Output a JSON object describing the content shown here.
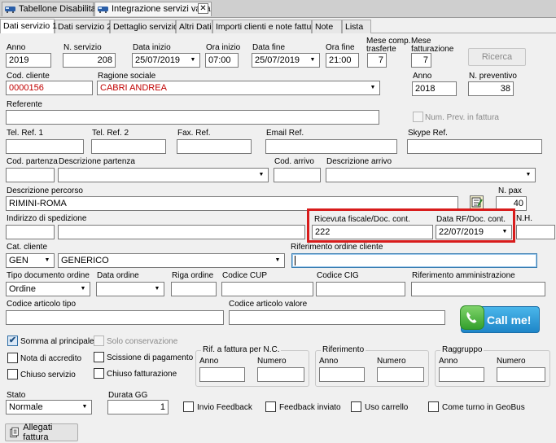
{
  "window_tabs": [
    {
      "label": "Tabellone Disabilitato"
    },
    {
      "label": "Integrazione servizi varia",
      "close": "✕"
    }
  ],
  "tabs": [
    "Dati servizio 1",
    "Dati servizio 2",
    "Dettaglio servizio",
    "Altri Dati",
    "Importi clienti e note fattura",
    "Note",
    "Lista"
  ],
  "row1": {
    "anno_label": "Anno",
    "anno": "2019",
    "n_servizio_label": "N. servizio",
    "n_servizio": "208",
    "data_inizio_label": "Data inizio",
    "data_inizio": "25/07/2019",
    "ora_inizio_label": "Ora inizio",
    "ora_inizio": "07:00",
    "data_fine_label": "Data fine",
    "data_fine": "25/07/2019",
    "ora_fine_label": "Ora fine",
    "ora_fine": "21:00",
    "mese_comp_label1": "Mese comp.",
    "mese_comp_label2": "trasferte",
    "mese_comp": "7",
    "mese_fatt_label1": "Mese",
    "mese_fatt_label2": "fatturazione",
    "mese_fatt": "7",
    "ricerca_label": "Ricerca"
  },
  "row2": {
    "cod_cliente_label": "Cod. cliente",
    "cod_cliente": "0000156",
    "ragione_sociale_label": "Ragione sociale",
    "ragione_sociale": "CABRI ANDREA",
    "anno_label": "Anno",
    "anno": "2018",
    "n_preventivo_label": "N. preventivo",
    "n_preventivo": "38"
  },
  "row3": {
    "referente_label": "Referente",
    "referente": "",
    "num_prev_label": "Num. Prev. in fattura"
  },
  "row4": {
    "tel1_label": "Tel. Ref. 1",
    "tel2_label": "Tel. Ref. 2",
    "fax_label": "Fax. Ref.",
    "email_label": "Email Ref.",
    "skype_label": "Skype Ref."
  },
  "row5": {
    "cod_partenza_label": "Cod. partenza",
    "desc_partenza_label": "Descrizione partenza",
    "cod_arrivo_label": "Cod. arrivo",
    "desc_arrivo_label": "Descrizione arrivo"
  },
  "row6": {
    "percorso_label": "Descrizione percorso",
    "percorso": "RIMINI-ROMA",
    "n_pax_label": "N. pax",
    "n_pax": "40"
  },
  "row7": {
    "indirizzo_label": "Indirizzo di spedizione",
    "ricevuta_label": "Ricevuta fiscale/Doc. cont.",
    "ricevuta": "222",
    "data_rf_label": "Data RF/Doc. cont.",
    "data_rf": "22/07/2019",
    "nh_label": "N.H."
  },
  "row8": {
    "cat_cliente_label": "Cat. cliente",
    "cat_cliente": "GEN",
    "cat_desc": "GENERICO",
    "riferimento_ordine_label": "Riferimento ordine cliente"
  },
  "row9": {
    "tipo_doc_label": "Tipo documento ordine",
    "tipo_doc": "Ordine",
    "data_ordine_label": "Data ordine",
    "riga_ordine_label": "Riga ordine",
    "cup_label": "Codice CUP",
    "cig_label": "Codice CIG",
    "rif_amm_label": "Riferimento amministrazione"
  },
  "row10": {
    "art_tipo_label": "Codice articolo tipo",
    "art_valore_label": "Codice articolo valore",
    "call_me": "Call me!"
  },
  "checks": {
    "somma": "Somma al principale",
    "solo_cons": "Solo conservazione",
    "nota": "Nota di accredito",
    "scissione": "Scissione di pagamento",
    "chiuso_serv": "Chiuso servizio",
    "chiuso_fatt": "Chiuso fatturazione",
    "check_mark": "✔"
  },
  "groups": {
    "rif_fattura": "Rif. a fattura per N.C.",
    "riferimento": "Riferimento",
    "raggruppo": "Raggruppo",
    "anno": "Anno",
    "numero": "Numero"
  },
  "bottom": {
    "stato_label": "Stato",
    "stato": "Normale",
    "durata_label": "Durata GG",
    "durata": "1",
    "invio_feedback": "Invio Feedback",
    "feedback_inviato": "Feedback inviato",
    "uso_carrello": "Uso carrello",
    "come_turno": "Come turno in GeoBus",
    "allegati": "Allegati fattura"
  },
  "colors": {
    "accent_red": "#d81c1c",
    "call_green": "#3fae3a",
    "call_blue": "#1e9de0"
  }
}
